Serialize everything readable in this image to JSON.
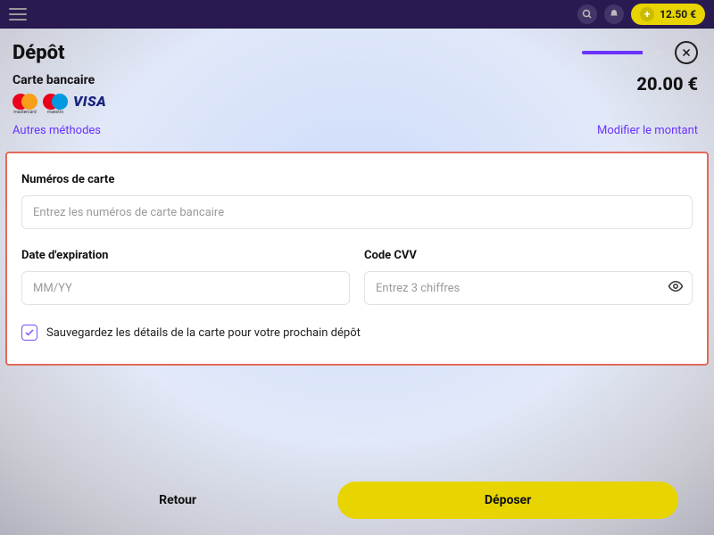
{
  "topbar": {
    "balance": "12.50 €"
  },
  "header": {
    "title": "Dépôt"
  },
  "method": {
    "title": "Carte bancaire",
    "logos": {
      "mc_label": "mastercard",
      "maestro_label": "maestro",
      "visa": "VISA"
    },
    "other_methods": "Autres méthodes"
  },
  "amount": {
    "value": "20.00 €",
    "edit": "Modifier le montant"
  },
  "form": {
    "card_number_label": "Numéros de carte",
    "card_number_placeholder": "Entrez les numéros de carte bancaire",
    "expiry_label": "Date d'expiration",
    "expiry_placeholder": "MM/YY",
    "cvv_label": "Code CVV",
    "cvv_placeholder": "Entrez 3 chiffres",
    "save_card": "Sauvegardez les détails de la carte pour votre prochain dépôt"
  },
  "footer": {
    "back": "Retour",
    "deposit": "Déposer"
  }
}
